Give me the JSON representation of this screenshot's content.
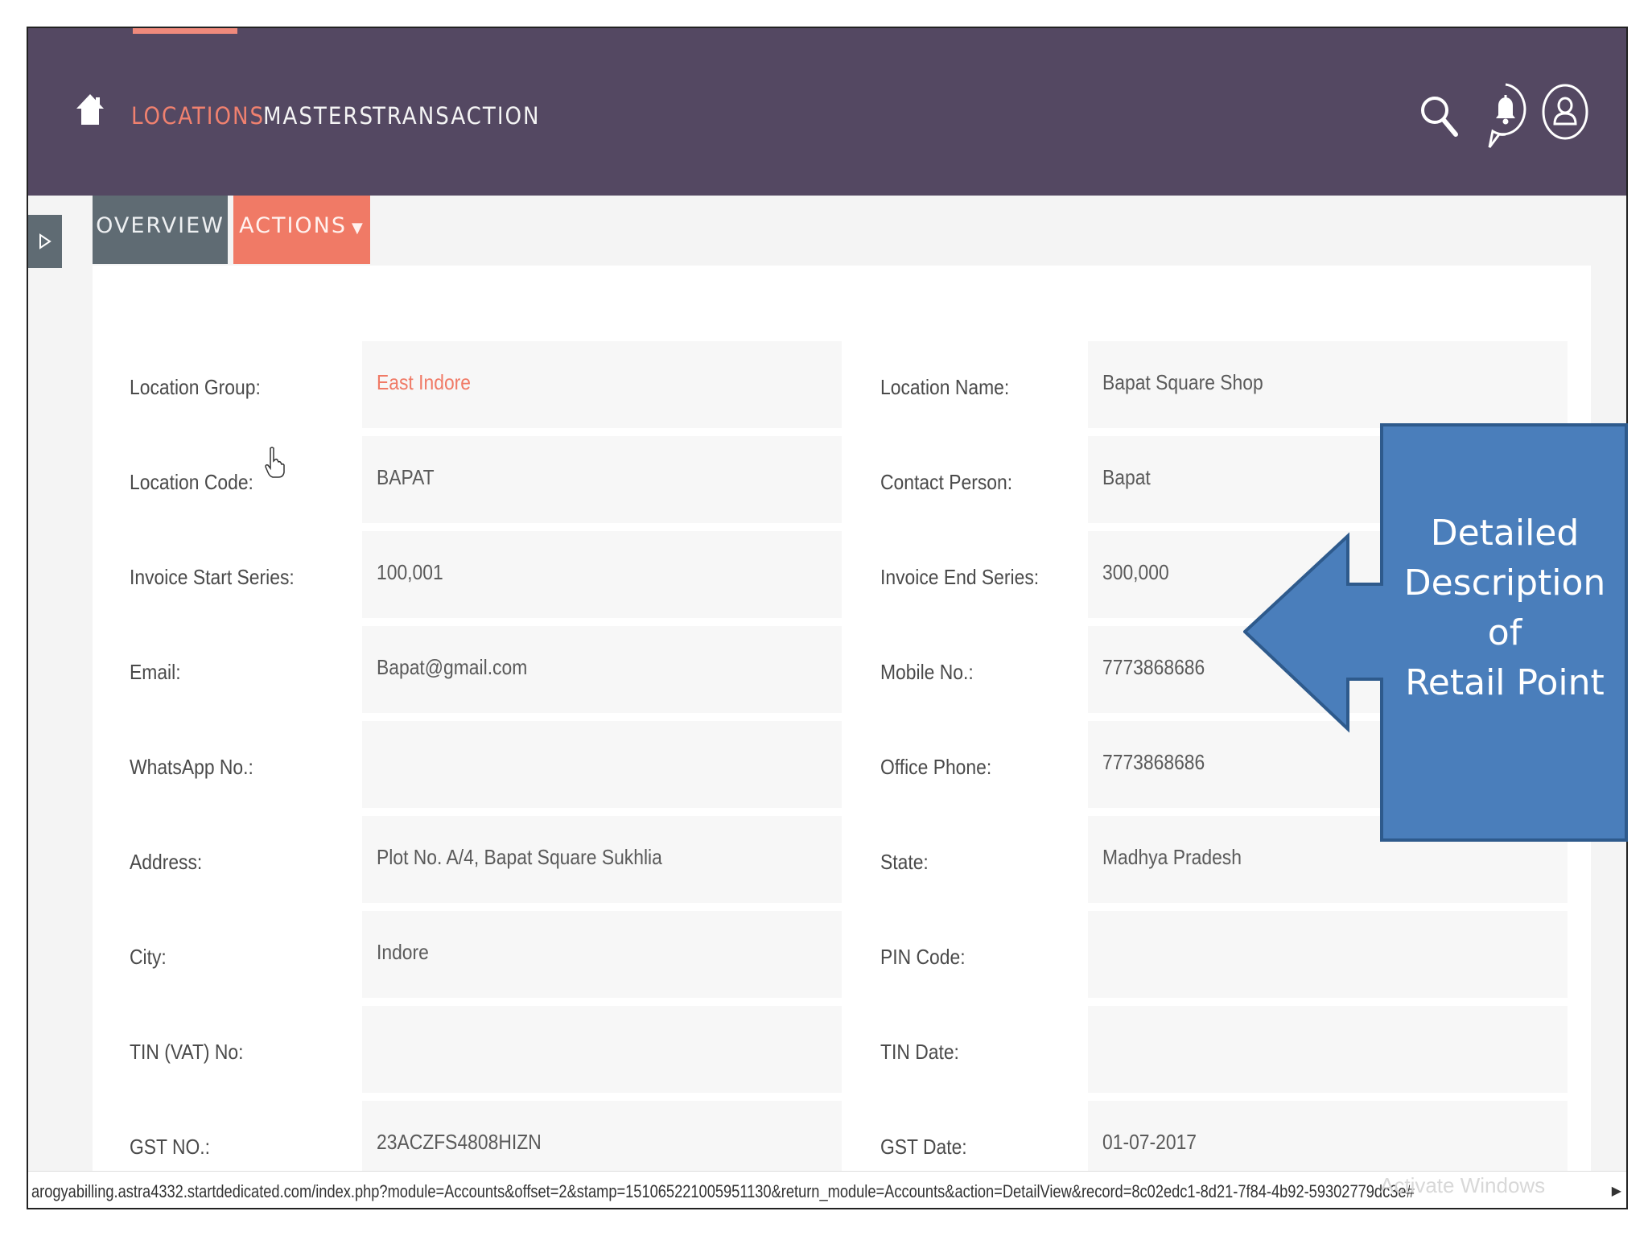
{
  "nav": {
    "items": [
      {
        "label": "LOCATIONS",
        "active": true
      },
      {
        "label": "MASTERS",
        "active": false
      },
      {
        "label": "TRANSACTION",
        "active": false
      }
    ],
    "icons": [
      "home-icon",
      "search-icon",
      "notification-bell-icon",
      "user-profile-icon"
    ]
  },
  "tabs": {
    "overview": "OVERVIEW",
    "actions": "ACTIONS"
  },
  "details": {
    "rows": [
      {
        "left_label": "Location Group:",
        "left_value": "East Indore",
        "right_label": "Location Name:",
        "right_value": "Bapat Square Shop"
      },
      {
        "left_label": "Location Code:",
        "left_value": "BAPAT",
        "right_label": "Contact Person:",
        "right_value": "Bapat"
      },
      {
        "left_label": "Invoice Start Series:",
        "left_value": "100,001",
        "right_label": "Invoice End Series:",
        "right_value": "300,000"
      },
      {
        "left_label": "Email:",
        "left_value": "Bapat@gmail.com",
        "right_label": "Mobile No.:",
        "right_value": "7773868686"
      },
      {
        "left_label": "WhatsApp No.:",
        "left_value": "",
        "right_label": "Office Phone:",
        "right_value": "7773868686"
      },
      {
        "left_label": "Address:",
        "left_value": "Plot No. A/4, Bapat Square Sukhlia",
        "right_label": "State:",
        "right_value": "Madhya Pradesh"
      },
      {
        "left_label": "City:",
        "left_value": "Indore",
        "right_label": "PIN Code:",
        "right_value": ""
      },
      {
        "left_label": "TIN (VAT) No:",
        "left_value": "",
        "right_label": "TIN Date:",
        "right_value": ""
      },
      {
        "left_label": "GST NO.:",
        "left_value": "23ACZFS4808HIZN",
        "right_label": "GST Date:",
        "right_value": "01-07-2017"
      }
    ]
  },
  "status_bar": {
    "url": "arogyabilling.astra4332.startdedicated.com/index.php?module=Accounts&offset=2&stamp=151065221005951130&return_module=Accounts&action=DetailView&record=8c02edc1-8d21-7f84-4b92-59302779dc3e#",
    "watermark": "Activate Windows"
  },
  "callout": {
    "lines": [
      "Detailed",
      "Description",
      "of",
      "Retail Point"
    ],
    "fill": "#4a7ebb",
    "stroke": "#2e5a8c"
  },
  "colors": {
    "nav_bg": "#544862",
    "accent": "#f07a66",
    "tab_grey": "#5f6b73"
  }
}
